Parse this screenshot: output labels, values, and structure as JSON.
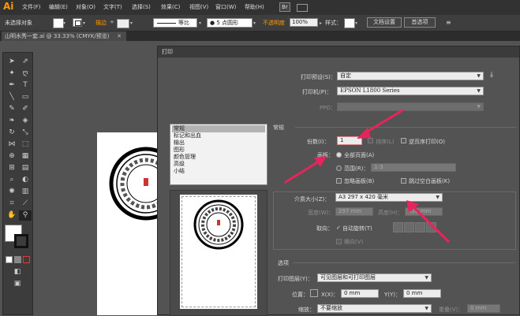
{
  "app": {
    "logo": "Ai",
    "menu": [
      "文件(F)",
      "编辑(E)",
      "对象(O)",
      "文字(T)",
      "选择(S)",
      "效果(C)",
      "视图(V)",
      "窗口(W)",
      "帮助(H)"
    ],
    "menu_badge": "Br"
  },
  "control_bar": {
    "selection": "未选择对象",
    "stroke_label": "描边",
    "stroke_spin": "÷",
    "uniform": "等比",
    "brush": "5 点圆形",
    "opacity_label": "不透明度",
    "opacity_value": "100%",
    "style_label": "样式：",
    "doc_setup": "文档设置",
    "preferences": "首选项"
  },
  "document_tab": {
    "title": "山明水秀一套.ai @ 33.33% (CMYK/预览)",
    "close": "✕"
  },
  "dialog": {
    "title": "打印",
    "print_preset_label": "打印预设(S)：",
    "print_preset_value": "自定",
    "printer_label": "打印机(P)：",
    "printer_value": "EPSON L1800 Series",
    "ppd_label": "PPD：",
    "nav_items": [
      "常规",
      "标记和出血",
      "输出",
      "图形",
      "颜色管理",
      "高级",
      "小结"
    ],
    "general": {
      "section": "常规",
      "copies_label": "份数(I)：",
      "copies_value": "1",
      "collate_label": "排序(L)",
      "reverse_label": "逆页序打印(O)",
      "artboard_label": "画板：",
      "all_pages": "全部页面(A)",
      "range_label": "范围(R)：",
      "range_value": "1-3",
      "ignore_artboards": "忽略画板(B)",
      "skip_blank": "跳过空白画板(K)"
    },
    "media": {
      "size_label": "介质大小(Z)：",
      "size_value": "A3 297 x 420 毫米",
      "width_label": "宽度(W)：",
      "width_value": "297 mm",
      "height_label": "高度(H)：",
      "height_value": "420 mm",
      "orientation_label": "取向：",
      "auto_rotate": "自动旋转(T)",
      "transverse": "横向(V)"
    },
    "options": {
      "section": "选项",
      "print_layers_label": "打印图层(Y)：",
      "print_layers_value": "可见图层和可打印图层",
      "position_label": "位置：",
      "x_label": "X(X)：",
      "x_value": "0 mm",
      "y_label": "Y(Y)：",
      "y_value": "0 mm",
      "scale_label": "缩放：",
      "scale_value": "不要缩放",
      "overlap_label": "重叠(V)：",
      "overlap_value": "0 mm"
    }
  },
  "colors": {
    "annotation_arrow": "#e8245d",
    "logo": "#ff9a00"
  }
}
